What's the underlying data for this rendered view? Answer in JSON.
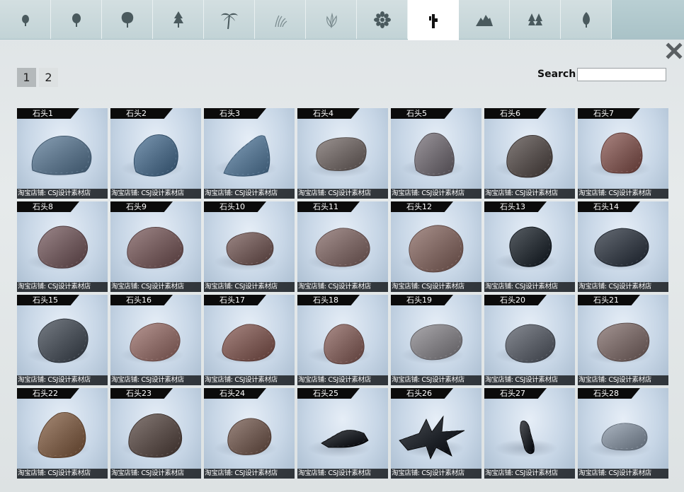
{
  "tabs": [
    {
      "icon": "small-shrub-icon"
    },
    {
      "icon": "round-tree-icon"
    },
    {
      "icon": "broad-tree-icon"
    },
    {
      "icon": "conifer-icon"
    },
    {
      "icon": "palm-tree-icon"
    },
    {
      "icon": "grass-icon"
    },
    {
      "icon": "leafy-plant-icon"
    },
    {
      "icon": "flower-icon"
    },
    {
      "icon": "rock-icon",
      "active": true
    },
    {
      "icon": "mountain-icon"
    },
    {
      "icon": "twin-pines-icon"
    },
    {
      "icon": "leaf-icon"
    }
  ],
  "pagination": {
    "pages": [
      "1",
      "2"
    ],
    "current": "1"
  },
  "search": {
    "label": "Search",
    "value": ""
  },
  "watermark": "淘宝店铺: CSJ设计素材店",
  "items": [
    {
      "name": "石头1",
      "color": "#5c7388"
    },
    {
      "name": "石头2",
      "color": "#4f6b85"
    },
    {
      "name": "石头3",
      "color": "#5a7791"
    },
    {
      "name": "石头4",
      "color": "#6e6664"
    },
    {
      "name": "石头5",
      "color": "#6f6a70"
    },
    {
      "name": "石头6",
      "color": "#57504e"
    },
    {
      "name": "石头7",
      "color": "#7d5854"
    },
    {
      "name": "石头8",
      "color": "#6f5a5d"
    },
    {
      "name": "石头9",
      "color": "#725a5b"
    },
    {
      "name": "石头10",
      "color": "#6f5a58"
    },
    {
      "name": "石头11",
      "color": "#7a6664"
    },
    {
      "name": "石头12",
      "color": "#7d6560"
    },
    {
      "name": "石头13",
      "color": "#2c3238"
    },
    {
      "name": "石头14",
      "color": "#3a4049"
    },
    {
      "name": "石头15",
      "color": "#4a5058"
    },
    {
      "name": "石头16",
      "color": "#8a6a66"
    },
    {
      "name": "石头17",
      "color": "#7b5a55"
    },
    {
      "name": "石头18",
      "color": "#7e605c"
    },
    {
      "name": "石头19",
      "color": "#7e7c80"
    },
    {
      "name": "石头20",
      "color": "#5a5e66"
    },
    {
      "name": "石头21",
      "color": "#776866"
    },
    {
      "name": "石头22",
      "color": "#7a5e4a"
    },
    {
      "name": "石头23",
      "color": "#5a4e4a"
    },
    {
      "name": "石头24",
      "color": "#6e5a52"
    },
    {
      "name": "石头25",
      "color": "#1f2227"
    },
    {
      "name": "石头26",
      "color": "#1e2228"
    },
    {
      "name": "石头27",
      "color": "#23262b"
    },
    {
      "name": "石头28",
      "color": "#7e8894"
    }
  ]
}
